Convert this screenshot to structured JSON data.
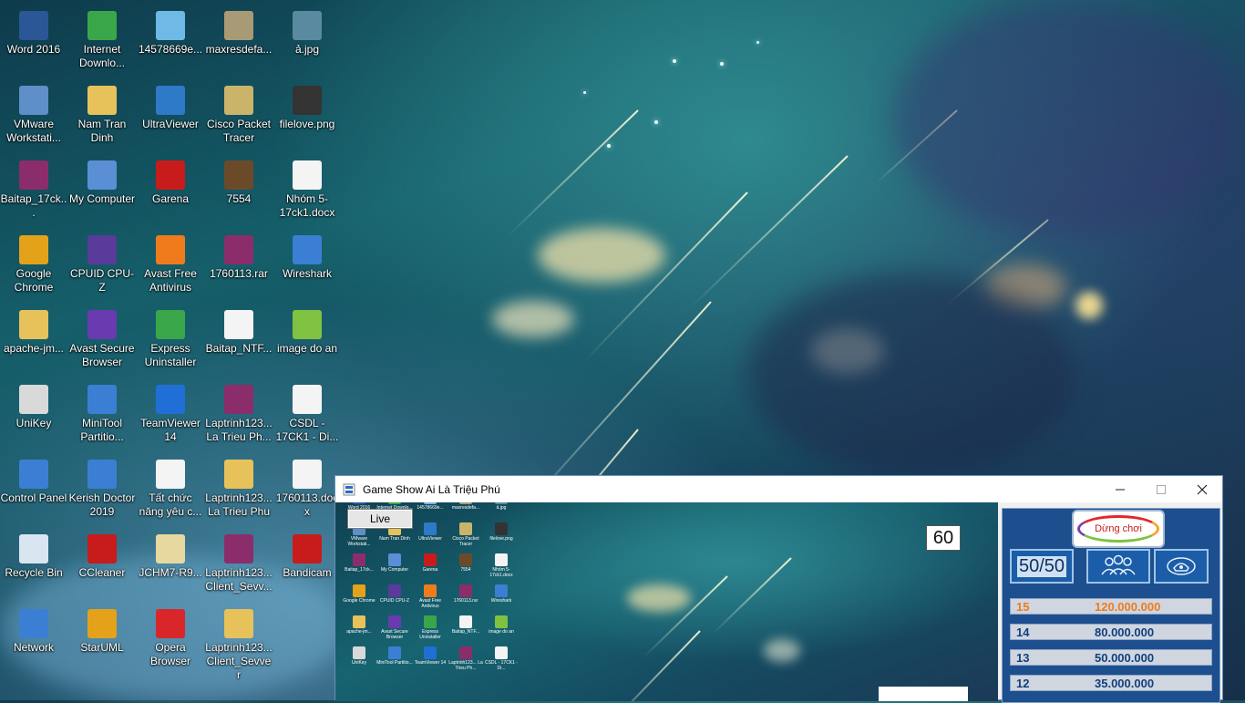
{
  "desktop": {
    "icons": [
      {
        "label": "Word 2016",
        "icon": "word-icon",
        "color": "#2b5797"
      },
      {
        "label": "Internet Downlo...",
        "icon": "idm-icon",
        "color": "#3aa64a"
      },
      {
        "label": "14578669e...",
        "icon": "image-file-icon",
        "color": "#6fb9e6"
      },
      {
        "label": "maxresdefa...",
        "icon": "image-file-icon",
        "color": "#a89a74"
      },
      {
        "label": "ả.jpg",
        "icon": "image-file-icon",
        "color": "#5a8aa0"
      },
      {
        "label": "VMware Workstati...",
        "icon": "vmware-icon",
        "color": "#5e8fc8"
      },
      {
        "label": "Nam Tran Dinh",
        "icon": "user-folder-icon",
        "color": "#e7c25a"
      },
      {
        "label": "UltraViewer",
        "icon": "ultraviewer-icon",
        "color": "#2f79c9"
      },
      {
        "label": "Cisco Packet Tracer",
        "icon": "cisco-icon",
        "color": "#c9b46a"
      },
      {
        "label": "filelove.png",
        "icon": "image-file-icon",
        "color": "#333333"
      },
      {
        "label": "Baitap_17ck...",
        "icon": "winrar-icon",
        "color": "#8c2d6b"
      },
      {
        "label": "My Computer",
        "icon": "computer-icon",
        "color": "#5a8fd6"
      },
      {
        "label": "Garena",
        "icon": "garena-icon",
        "color": "#c81b1b"
      },
      {
        "label": "7554",
        "icon": "game-icon",
        "color": "#6b4a2a"
      },
      {
        "label": "Nhóm 5-17ck1.docx",
        "icon": "docx-file-icon",
        "color": "#f4f4f4"
      },
      {
        "label": "Google Chrome",
        "icon": "chrome-icon",
        "color": "#e3a21a"
      },
      {
        "label": "CPUID CPU-Z",
        "icon": "cpuz-icon",
        "color": "#5a3a9a"
      },
      {
        "label": "Avast Free Antivirus",
        "icon": "avast-icon",
        "color": "#f07b1c"
      },
      {
        "label": "1760113.rar",
        "icon": "winrar-icon",
        "color": "#8c2d6b"
      },
      {
        "label": "Wireshark",
        "icon": "wireshark-icon",
        "color": "#3b7fd4"
      },
      {
        "label": "apache-jm...",
        "icon": "zip-folder-icon",
        "color": "#e7c25a"
      },
      {
        "label": "Avast Secure Browser",
        "icon": "avast-browser-icon",
        "color": "#6a3ab0"
      },
      {
        "label": "Express Uninstaller",
        "icon": "uninstaller-icon",
        "color": "#3aa64a"
      },
      {
        "label": "Baitap_NTF...",
        "icon": "document-file-icon",
        "color": "#f4f4f4"
      },
      {
        "label": "image do an",
        "icon": "zip-folder-icon",
        "color": "#7fc242"
      },
      {
        "label": "UniKey",
        "icon": "unikey-icon",
        "color": "#d9d9d9"
      },
      {
        "label": "MiniTool Partitio...",
        "icon": "minitool-icon",
        "color": "#3b7fd4"
      },
      {
        "label": "TeamViewer 14",
        "icon": "teamviewer-icon",
        "color": "#1f6fd6"
      },
      {
        "label": "Laptrinh123... La Trieu Ph...",
        "icon": "winrar-icon",
        "color": "#8c2d6b"
      },
      {
        "label": "CSDL - 17CK1 - Di...",
        "icon": "excel-file-icon",
        "color": "#f4f4f4"
      },
      {
        "label": "Control Panel",
        "icon": "control-panel-icon",
        "color": "#3b7fd4"
      },
      {
        "label": "Kerish Doctor 2019",
        "icon": "kerish-icon",
        "color": "#3b7fd4"
      },
      {
        "label": "Tất chức năng yêu c...",
        "icon": "document-file-icon",
        "color": "#f4f4f4"
      },
      {
        "label": "Laptrinh123... La Trieu Phu",
        "icon": "zip-folder-icon",
        "color": "#e7c25a"
      },
      {
        "label": "1760113.docx",
        "icon": "docx-file-icon",
        "color": "#f4f4f4"
      },
      {
        "label": "Recycle Bin",
        "icon": "recycle-bin-icon",
        "color": "#d9e6f2"
      },
      {
        "label": "CCleaner",
        "icon": "ccleaner-icon",
        "color": "#c81b1b"
      },
      {
        "label": "JCHM7-R9...",
        "icon": "document-file-icon",
        "color": "#e7d8a0"
      },
      {
        "label": "Laptrinh123... Client_Sevv...",
        "icon": "winrar-icon",
        "color": "#8c2d6b"
      },
      {
        "label": "Bandicam",
        "icon": "bandicam-icon",
        "color": "#c81b1b"
      },
      {
        "label": "Network",
        "icon": "network-icon",
        "color": "#3b7fd4"
      },
      {
        "label": "StarUML",
        "icon": "staruml-icon",
        "color": "#e3a21a"
      },
      {
        "label": "Opera Browser",
        "icon": "opera-icon",
        "color": "#d9262a"
      },
      {
        "label": "Laptrinh123... Client_Sevver",
        "icon": "zip-folder-icon",
        "color": "#e7c25a"
      }
    ]
  },
  "window": {
    "title": "Game Show Ai Là Triệu Phú",
    "live_button": "Live",
    "timer": "60",
    "quit_button": "Dừng chơi",
    "lifelines": [
      {
        "label": "50/50",
        "icon": "fifty-fifty-icon"
      },
      {
        "label": "",
        "icon": "ask-audience-icon"
      },
      {
        "label": "",
        "icon": "phone-friend-icon"
      }
    ],
    "prize_ladder": [
      {
        "level": "15",
        "amount": "120.000.000"
      },
      {
        "level": "14",
        "amount": "80.000.000"
      },
      {
        "level": "13",
        "amount": "50.000.000"
      },
      {
        "level": "12",
        "amount": "35.000.000"
      }
    ],
    "mini_desktop_labels": [
      "Word 2016",
      "Internet Downlo...",
      "14578669e...",
      "maxresdefa...",
      "ả.jpg",
      "VMware Workstati...",
      "Nam Tran Dinh",
      "UltraViewer",
      "Cisco Packet Tracer",
      "filelove.png",
      "Baitap_17ck...",
      "My Computer",
      "Garena",
      "7554",
      "Nhóm 5-17ck1.docx",
      "Google Chrome",
      "CPUID CPU-Z",
      "Avast Free Antivirus",
      "1760113.rar",
      "Wireshark",
      "apache-jm...",
      "Avast Secure Browser",
      "Express Uninstaller",
      "Baitap_NTF...",
      "image do an",
      "UniKey",
      "MiniTool Partitio...",
      "TeamViewer 14",
      "Laptrinh123... La Trieu Ph...",
      "CSDL - 17CK1 - Di..."
    ]
  }
}
